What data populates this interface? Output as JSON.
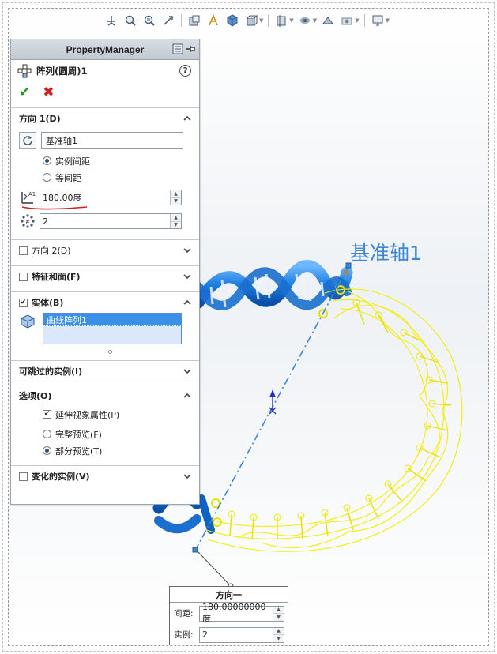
{
  "toolbar": {
    "icons": [
      "view-orient-icon",
      "zoom-to-fit-icon",
      "zoom-area-icon",
      "previous-view-icon",
      "section-view-icon",
      "dynamic-annotation-icon",
      "view-orientation-cube-icon",
      "display-style-icon",
      "hide-show-icon",
      "appearance-icon",
      "scene-icon",
      "view-settings-icon"
    ]
  },
  "scene": {
    "axis_label": "基准轴1"
  },
  "property_manager": {
    "header": "PropertyManager",
    "feature_title": "阵列(圆周)1",
    "help": "?",
    "ok": "✔",
    "cancel": "✖",
    "direction1": {
      "label": "方向 1(D)",
      "axis_value": "基准轴1",
      "option_instance_spacing": "实例间距",
      "option_equal_spacing": "等间距",
      "angle_value": "180.00度",
      "count_value": "2"
    },
    "direction2": {
      "label": "方向 2(D)"
    },
    "features_faces": {
      "label": "特征和面(F)"
    },
    "bodies": {
      "label": "实体(B)",
      "selected_body": "曲线阵列1"
    },
    "skip_instances": {
      "label": "可跳过的实例(I)"
    },
    "options": {
      "label": "选项(O)",
      "propagate_visual": "延伸视象属性(P)",
      "full_preview": "完整预览(F)",
      "partial_preview": "部分预览(T)"
    },
    "vary_instances": {
      "label": "变化的实例(V)"
    }
  },
  "callout": {
    "title": "方向一",
    "spacing_label": "间距:",
    "spacing_value": "180.00000000度",
    "count_label": "实例:",
    "count_value": "2"
  },
  "colors": {
    "dna_blue": "#1e7fe0",
    "preview_yellow": "#f3f000",
    "axis_line": "#3f86cf",
    "accent_red": "#d21d1d",
    "accent_green": "#1e9a1e"
  }
}
